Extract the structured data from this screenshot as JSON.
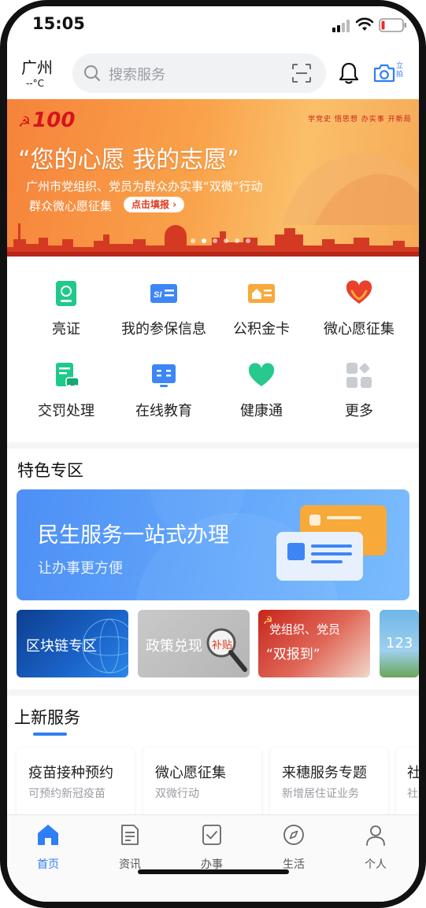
{
  "status": {
    "time": "15:05"
  },
  "header": {
    "city": "广州",
    "temp": "--°C",
    "search_placeholder": "搜索服务",
    "camera_label": "立拍"
  },
  "banner": {
    "logo": "100",
    "stamps": "学党史 悟思想 办实事 开新局",
    "headline": "“您的心愿 我的志愿”",
    "line1": "广州市党组织、党员为群众办实事“双微”行动",
    "line2": "群众微心愿征集",
    "cta": "点击填报 ›",
    "slide_count": 6,
    "active_slide": 1
  },
  "quick": [
    {
      "label": "亮证",
      "icon": "id-card-icon",
      "color": "#1fc98a"
    },
    {
      "label": "我的参保信息",
      "icon": "social-security-card-icon",
      "color": "#3d86f4"
    },
    {
      "label": "公积金卡",
      "icon": "housing-fund-card-icon",
      "color": "#f7a93a"
    },
    {
      "label": "微心愿征集",
      "icon": "heart-hands-icon",
      "color": "#e8412c"
    },
    {
      "label": "交罚处理",
      "icon": "traffic-fine-icon",
      "color": "#1fc98a"
    },
    {
      "label": "在线教育",
      "icon": "book-icon",
      "color": "#3d86f4"
    },
    {
      "label": "健康通",
      "icon": "health-heart-icon",
      "color": "#27c98e"
    },
    {
      "label": "更多",
      "icon": "more-grid-icon",
      "color": "#c9ccd1"
    }
  ],
  "feature": {
    "title": "特色专区",
    "main_title": "民生服务一站式办理",
    "main_sub": "让办事更方便",
    "minis": [
      {
        "label": "区块链专区"
      },
      {
        "label": "政策兑现",
        "tag": "补贴"
      },
      {
        "label": "党组织、党员",
        "label2": "“双报到”"
      },
      {
        "label": "123"
      }
    ]
  },
  "new_services": {
    "title": "上新服务",
    "cards": [
      {
        "title": "疫苗接种预约",
        "sub": "可预约新冠疫苗"
      },
      {
        "title": "微心愿征集",
        "sub": "双微行动"
      },
      {
        "title": "来穗服务专题",
        "sub": "新增居住证业务"
      },
      {
        "title": "社",
        "sub": "社"
      }
    ]
  },
  "tabs": [
    {
      "label": "首页",
      "icon": "home-icon",
      "active": true
    },
    {
      "label": "资讯",
      "icon": "news-doc-icon",
      "active": false
    },
    {
      "label": "办事",
      "icon": "checkbox-task-icon",
      "active": false
    },
    {
      "label": "生活",
      "icon": "compass-icon",
      "active": false
    },
    {
      "label": "个人",
      "icon": "person-icon",
      "active": false
    }
  ],
  "colors": {
    "accent": "#2f7ef5",
    "banner": "#f6833b"
  }
}
